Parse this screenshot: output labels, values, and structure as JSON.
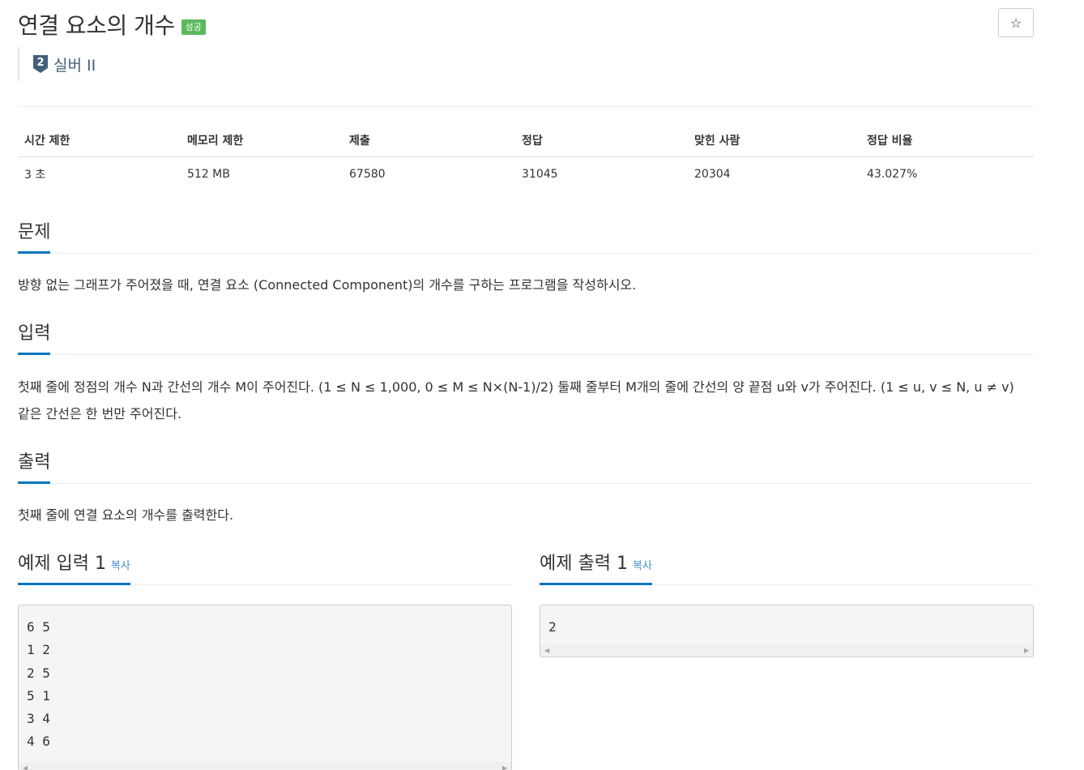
{
  "problem": {
    "title": "연결 요소의 개수",
    "status_badge": "성공",
    "tier_number": "2",
    "tier_label": "실버 II",
    "star_icon": "☆"
  },
  "info_table": {
    "headers": [
      "시간 제한",
      "메모리 제한",
      "제출",
      "정답",
      "맞힌 사람",
      "정답 비율"
    ],
    "values": [
      "3 초",
      "512 MB",
      "67580",
      "31045",
      "20304",
      "43.027%"
    ]
  },
  "sections": {
    "description": {
      "title": "문제",
      "text": "방향 없는 그래프가 주어졌을 때, 연결 요소 (Connected Component)의 개수를 구하는 프로그램을 작성하시오."
    },
    "input": {
      "title": "입력",
      "text": "첫째 줄에 정점의 개수 N과 간선의 개수 M이 주어진다. (1 ≤ N ≤ 1,000, 0 ≤ M ≤ N×(N-1)/2) 둘째 줄부터 M개의 줄에 간선의 양 끝점 u와 v가 주어진다. (1 ≤ u, v ≤ N, u ≠ v) 같은 간선은 한 번만 주어진다."
    },
    "output": {
      "title": "출력",
      "text": "첫째 줄에 연결 요소의 개수를 출력한다."
    }
  },
  "samples": {
    "input_title": "예제 입력 1",
    "output_title": "예제 출력 1",
    "copy_label": "복사",
    "input_text": "6 5\n1 2\n2 5\n5 1\n3 4\n4 6",
    "output_text": "2"
  },
  "colors": {
    "accent": "#0076c0",
    "success": "#5cb85c",
    "link": "#428bca",
    "tier": "#435f7a"
  }
}
